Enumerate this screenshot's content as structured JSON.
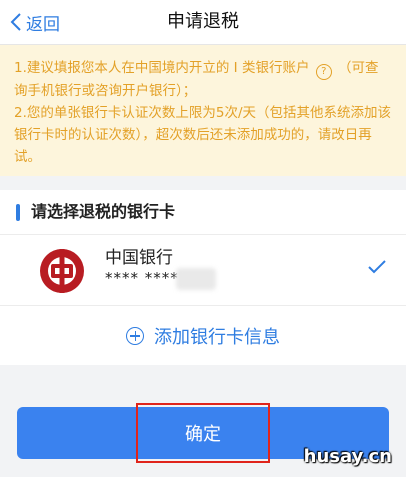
{
  "nav": {
    "back_label": "返回",
    "title": "申请退税"
  },
  "notice": {
    "line1a": "1.建议填报您本人在中国境内开立的 I 类银行账户",
    "help_glyph": "?",
    "line1b": "（可查询手机银行或咨询开户银行）；",
    "line2": "2.您的单张银行卡认证次数上限为5次/天（包括其他系统添加该银行卡时的认证次数），超次数后还未添加成功的，请改日再试。"
  },
  "section": {
    "title": "请选择退税的银行卡"
  },
  "bank": {
    "name": "中国银行",
    "card_number_masked": "**** ****",
    "logo_color": "#b81c22"
  },
  "add_card": {
    "label": "添加银行卡信息"
  },
  "confirm": {
    "label": "确定"
  },
  "watermark": {
    "text": "husay.cn"
  },
  "colors": {
    "accent": "#2f7de1",
    "notice_text": "#e3a128",
    "notice_bg": "#fdf5dc",
    "highlight": "#e0241b"
  }
}
